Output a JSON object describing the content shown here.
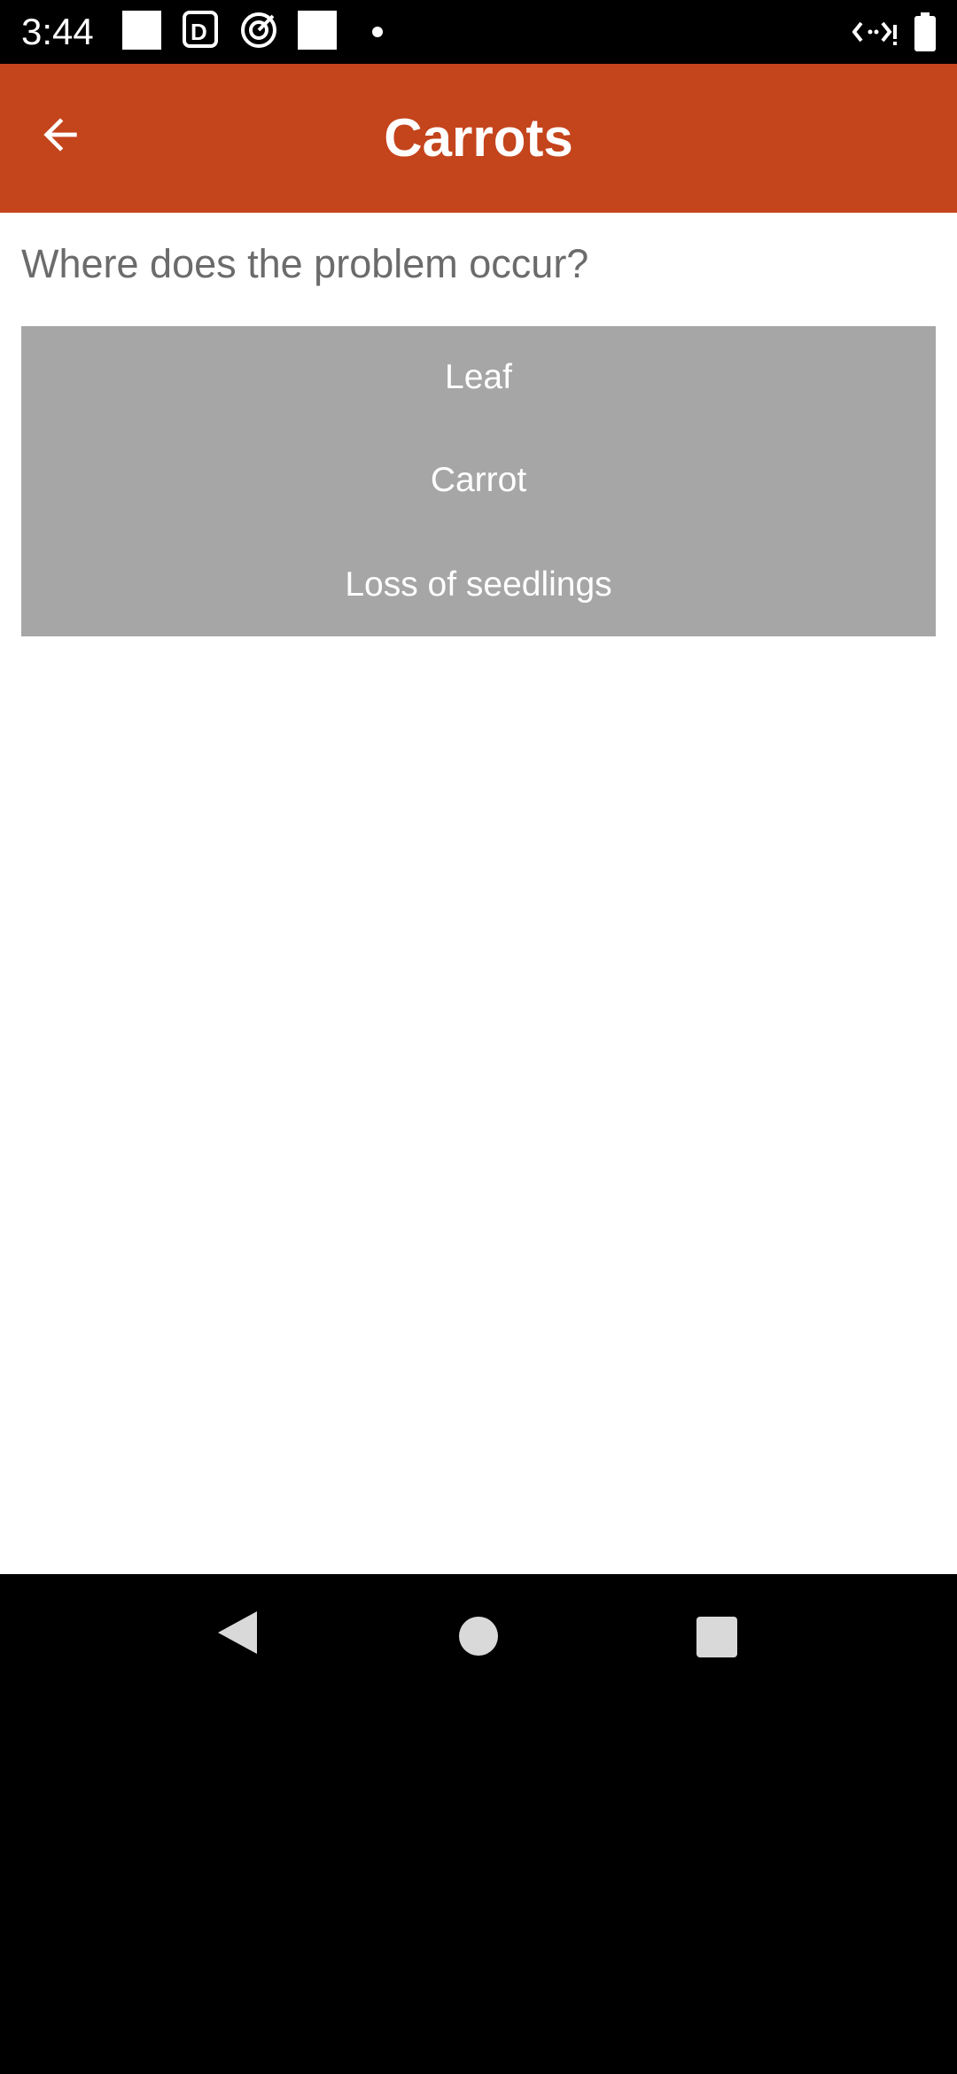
{
  "status_bar": {
    "time": "3:44"
  },
  "app_bar": {
    "title": "Carrots",
    "back_icon": "arrow-back-icon"
  },
  "main": {
    "question": "Where does the problem occur?",
    "options": [
      {
        "label": "Leaf"
      },
      {
        "label": "Carrot"
      },
      {
        "label": "Loss of seedlings"
      }
    ]
  },
  "nav_bar": {
    "back_icon": "triangle-back-icon",
    "home_icon": "circle-home-icon",
    "recents_icon": "square-recents-icon"
  },
  "colors": {
    "app_bar": "#C4441C",
    "options_bg": "#A6A6A6",
    "question_text": "#6b6b6b"
  }
}
